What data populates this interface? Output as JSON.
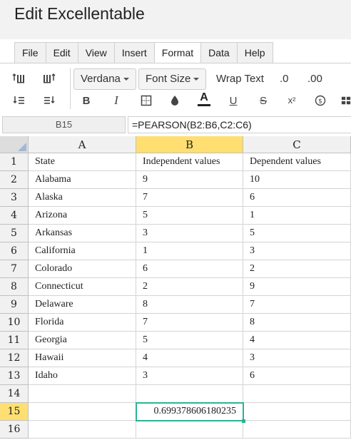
{
  "app": {
    "title": "Edit Excellentable"
  },
  "menu_tabs": [
    {
      "label": "File"
    },
    {
      "label": "Edit"
    },
    {
      "label": "View"
    },
    {
      "label": "Insert"
    },
    {
      "label": "Format"
    },
    {
      "label": "Data"
    },
    {
      "label": "Help"
    }
  ],
  "active_tab": "Format",
  "toolbar": {
    "font_family": "Verdana",
    "font_size_label": "Font Size",
    "wrap_text_label": "Wrap Text",
    "decrease_decimal_label": ".0",
    "increase_decimal_label": ".00",
    "bold_label": "B",
    "italic_label": "I",
    "underline_label": "U",
    "strike_label": "S",
    "superscript_label": "x²",
    "font_color_label": "A"
  },
  "formula_bar": {
    "cell_ref": "B15",
    "formula": "=PEARSON(B2:B6,C2:C6)"
  },
  "grid": {
    "columns": [
      "A",
      "B",
      "C"
    ],
    "selected_column": "B",
    "selected_row": "15",
    "rows": [
      {
        "num": "1",
        "a": "State",
        "b": "Independent values",
        "c": "Dependent values"
      },
      {
        "num": "2",
        "a": "Alabama",
        "b": "9",
        "c": "10"
      },
      {
        "num": "3",
        "a": "Alaska",
        "b": "7",
        "c": "6"
      },
      {
        "num": "4",
        "a": "Arizona",
        "b": "5",
        "c": "1"
      },
      {
        "num": "5",
        "a": "Arkansas",
        "b": "3",
        "c": "5"
      },
      {
        "num": "6",
        "a": "California",
        "b": "1",
        "c": "3"
      },
      {
        "num": "7",
        "a": "Colorado",
        "b": "6",
        "c": "2"
      },
      {
        "num": "8",
        "a": "Connecticut",
        "b": "2",
        "c": "9"
      },
      {
        "num": "9",
        "a": "Delaware",
        "b": "8",
        "c": "7"
      },
      {
        "num": "10",
        "a": "Florida",
        "b": "7",
        "c": "8"
      },
      {
        "num": "11",
        "a": "Georgia",
        "b": "5",
        "c": "4"
      },
      {
        "num": "12",
        "a": "Hawaii",
        "b": "4",
        "c": "3"
      },
      {
        "num": "13",
        "a": "Idaho",
        "b": "3",
        "c": "6"
      },
      {
        "num": "14",
        "a": "",
        "b": "",
        "c": ""
      },
      {
        "num": "15",
        "a": "",
        "b": "0.699378606180235",
        "c": ""
      },
      {
        "num": "16",
        "a": "",
        "b": "",
        "c": ""
      }
    ]
  },
  "colors": {
    "selection": "#2bb394",
    "header_highlight": "#ffdf72"
  }
}
